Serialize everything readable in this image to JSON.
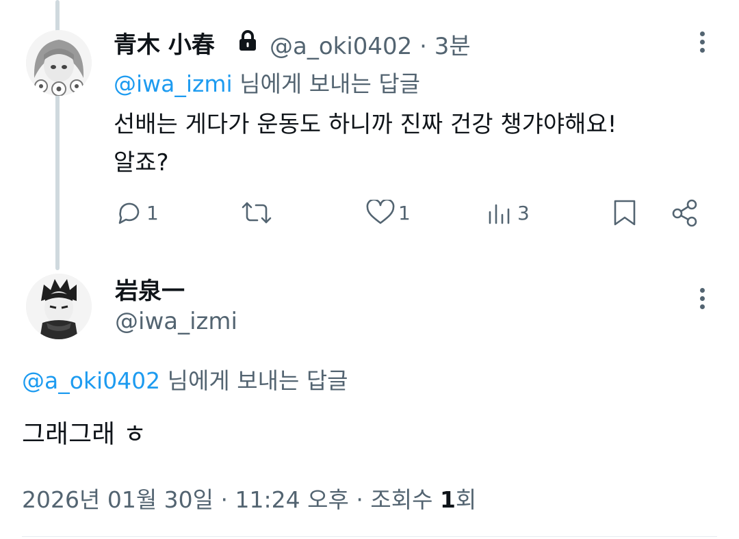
{
  "reply_tweet": {
    "display_name": "青木 小春",
    "handle": "@a_oki0402",
    "separator": "·",
    "time": "3분",
    "reply_to_handle": "@iwa_izmi",
    "reply_to_suffix": " 님에게 보내는 답글",
    "text_line1": "선배는 게다가 운동도 하니까 진짜 건강 챙갸야해요!",
    "text_line2": "알죠?",
    "reply_count": "1",
    "like_count": "1",
    "view_count": "3",
    "icons": [
      "lock-icon",
      "more-icon",
      "reply-icon",
      "retweet-icon",
      "like-icon",
      "views-icon",
      "bookmark-icon",
      "share-icon"
    ]
  },
  "main_tweet": {
    "display_name": "岩泉一",
    "handle": "@iwa_izmi",
    "reply_to_handle": "@a_oki0402",
    "reply_to_suffix": " 님에게 보내는 답글",
    "text": "그래그래 ㅎ",
    "date": "2026년 01월 30일",
    "separator": "·",
    "time": "11:24 오후",
    "views_label": "조회수",
    "views_count": "1",
    "views_suffix": "회"
  },
  "colors": {
    "link": "#1d9bf0",
    "secondary": "#536471",
    "primary": "#0f1419",
    "thread_line": "#cfd9de"
  }
}
